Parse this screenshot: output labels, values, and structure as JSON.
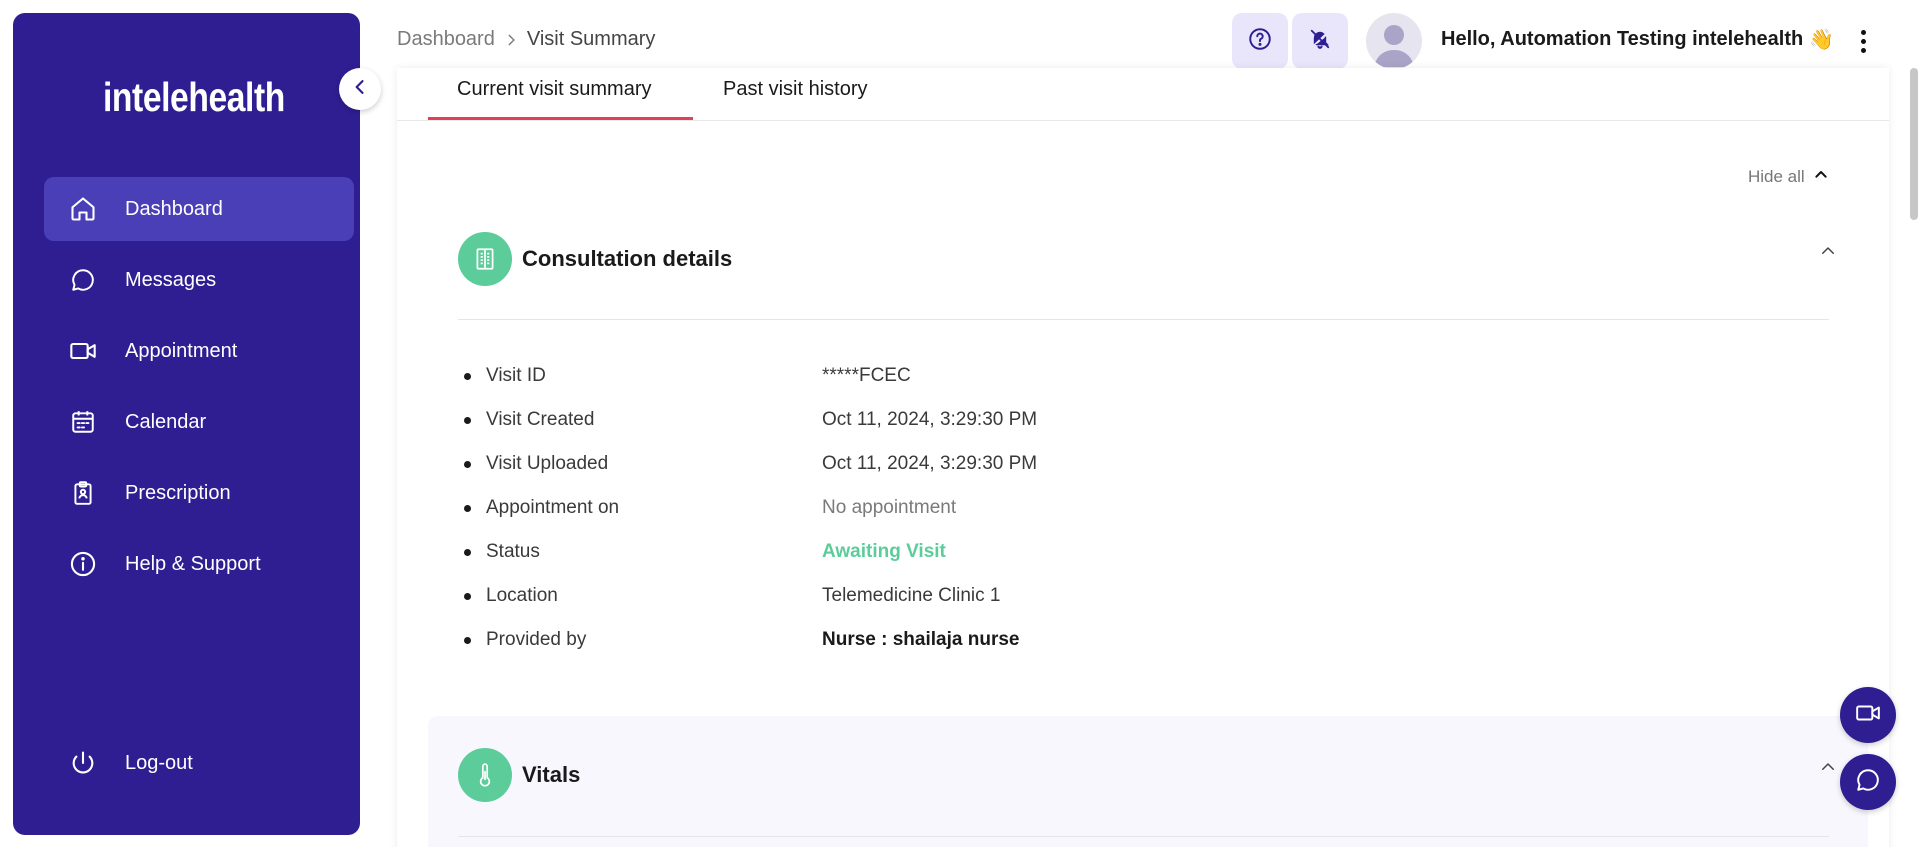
{
  "brand": {
    "name": "intelehealth"
  },
  "sidebar": {
    "items": [
      {
        "label": "Dashboard",
        "icon": "home-icon",
        "active": true
      },
      {
        "label": "Messages",
        "icon": "chat-icon",
        "active": false
      },
      {
        "label": "Appointment",
        "icon": "video-icon",
        "active": false
      },
      {
        "label": "Calendar",
        "icon": "calendar-icon",
        "active": false
      },
      {
        "label": "Prescription",
        "icon": "clipboard-icon",
        "active": false
      },
      {
        "label": "Help & Support",
        "icon": "info-icon",
        "active": false
      }
    ],
    "logout_label": "Log-out"
  },
  "header": {
    "breadcrumb": {
      "root": "Dashboard",
      "current": "Visit Summary"
    },
    "greeting": "Hello, Automation Testing intelehealth",
    "greeting_emoji": "👋"
  },
  "tabs": [
    {
      "label": "Current visit summary",
      "active": true
    },
    {
      "label": "Past visit history",
      "active": false
    }
  ],
  "hide_all_label": "Hide all",
  "consultation": {
    "title": "Consultation details",
    "rows": [
      {
        "label": "Visit ID",
        "value": "*****FCEC"
      },
      {
        "label": "Visit Created",
        "value": "Oct 11, 2024, 3:29:30 PM"
      },
      {
        "label": "Visit Uploaded",
        "value": "Oct 11, 2024, 3:29:30 PM"
      },
      {
        "label": "Appointment on",
        "value": "No appointment"
      },
      {
        "label": "Status",
        "value": "Awaiting Visit"
      },
      {
        "label": "Location",
        "value": "Telemedicine Clinic 1"
      },
      {
        "label": "Provided by",
        "value": "Nurse : shailaja nurse"
      }
    ]
  },
  "vitals": {
    "title": "Vitals"
  },
  "colors": {
    "sidebar_bg": "#2e1e91",
    "sidebar_active": "#4b3fb8",
    "accent_green": "#5ccc9a",
    "tab_underline": "#e0405a"
  }
}
